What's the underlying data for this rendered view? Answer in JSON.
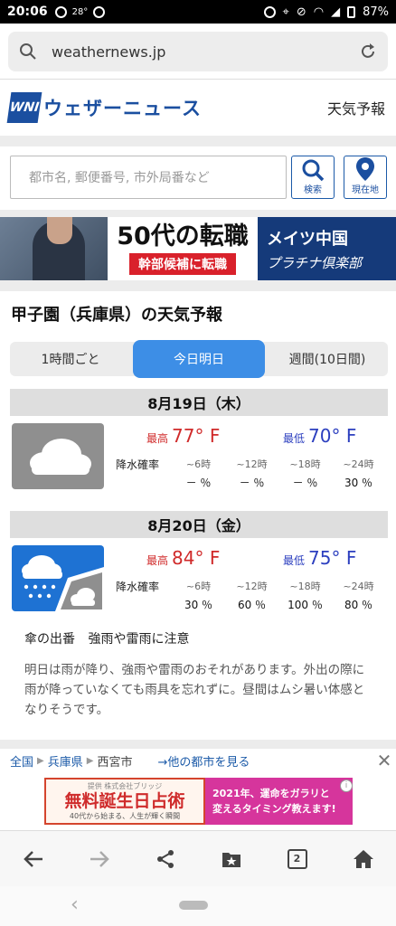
{
  "status_bar": {
    "time": "20:06",
    "temp": "28°",
    "battery": "87%"
  },
  "browser": {
    "url": "weathernews.jp"
  },
  "header": {
    "logo_mark": "WNI",
    "logo_text": "ウェザーニュース",
    "nav_link": "天気予報"
  },
  "search": {
    "placeholder": "都市名, 郵便番号, 市外局番など",
    "search_label": "検索",
    "location_label": "現在地"
  },
  "top_ad": {
    "headline": "50代の転職",
    "sub": "幹部候補に転職",
    "brand": "メイツ中国",
    "tagline": "プラチナ倶楽部"
  },
  "forecast": {
    "title": "甲子園（兵庫県）の天気予報",
    "tabs": [
      "1時間ごと",
      "今日明日",
      "週間(10日間)"
    ],
    "rain_label": "降水確率",
    "days": [
      {
        "date": "8月19日（木）",
        "weather": "cloudy-icon",
        "hi_label": "最高",
        "hi": "77°  F",
        "lo_label": "最低",
        "lo": "70°  F",
        "hours": [
          "~6時",
          "~12時",
          "~18時",
          "~24時"
        ],
        "precip": [
          "－ ％",
          "－ ％",
          "－ ％",
          "30 ％"
        ]
      },
      {
        "date": "8月20日（金）",
        "weather": "rain-then-cloudy-icon",
        "hi_label": "最高",
        "hi": "84°  F",
        "lo_label": "最低",
        "lo": "75°  F",
        "hours": [
          "~6時",
          "~12時",
          "~18時",
          "~24時"
        ],
        "precip": [
          "30 ％",
          "60 ％",
          "100 ％",
          "80 ％"
        ]
      }
    ],
    "umbrella_label": "傘の出番",
    "umbrella_note": "強雨や雷雨に注意",
    "text": "明日は雨が降り、強雨や雷雨のおそれがあります。外出の際に雨が降っていなくても雨具を忘れずに。昼間はムシ暑い体感となりそうです。"
  },
  "breadcrumb": {
    "items": [
      "全国",
      "兵庫県",
      "西宮市"
    ],
    "other": "→他の都市を見る"
  },
  "bottom_ad": {
    "provider": "提供 株式会社ブリッジ",
    "headline": "無料誕生日占術",
    "sub": "40代から始まる、人生が輝く瞬間",
    "right_line1": "2021年、運命をガラリと",
    "right_line2": "変えるタイミング教えます!"
  },
  "browser_bar": {
    "tab_count": "2"
  }
}
